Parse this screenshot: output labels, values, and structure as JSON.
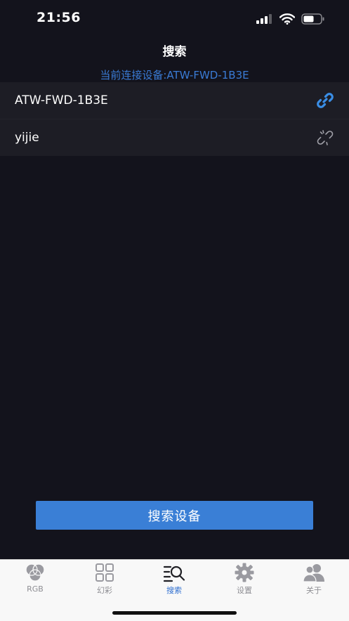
{
  "status_bar": {
    "time": "21:56",
    "icons": [
      "signal-icon",
      "wifi-icon",
      "battery-icon"
    ]
  },
  "header": {
    "title": "搜索"
  },
  "connection": {
    "label": "当前连接设备:ATW-FWD-1B3E"
  },
  "devices": [
    {
      "name": "ATW-FWD-1B3E",
      "icon": "link-icon",
      "connected": true
    },
    {
      "name": "yijie",
      "icon": "unlink-icon",
      "connected": false
    }
  ],
  "actions": {
    "search_label": "搜索设备"
  },
  "tabs": [
    {
      "label": "RGB",
      "icon": "rgb-icon",
      "active": false
    },
    {
      "label": "幻彩",
      "icon": "grid-icon",
      "active": false
    },
    {
      "label": "搜索",
      "icon": "search-list-icon",
      "active": true
    },
    {
      "label": "设置",
      "icon": "gear-icon",
      "active": false
    },
    {
      "label": "关于",
      "icon": "users-icon",
      "active": false
    }
  ],
  "colors": {
    "background": "#13131c",
    "row": "#1d1d25",
    "accent": "#3a7fd6",
    "tab_active": "#2f6fd0",
    "tab_inactive": "#8e8e93"
  }
}
